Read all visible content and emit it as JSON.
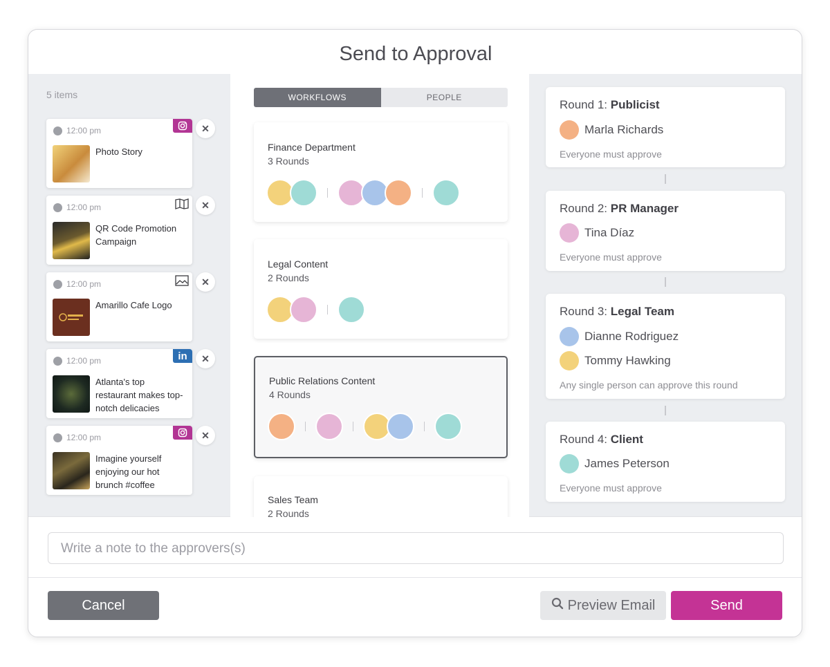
{
  "dialog": {
    "title": "Send to Approval"
  },
  "left": {
    "count_label": "5 items",
    "items": [
      {
        "time": "12:00 pm",
        "text": "Photo Story",
        "network": "instagram-icon",
        "badge_color": "#b23594"
      },
      {
        "time": "12:00 pm",
        "text": "QR Code Promotion Campaign",
        "network": "book-icon",
        "badge_color": ""
      },
      {
        "time": "12:00 pm",
        "text": "Amarillo Cafe Logo",
        "network": "image-icon",
        "badge_color": ""
      },
      {
        "time": "12:00 pm",
        "text": "Atlanta's top restaurant makes top-notch delicacies",
        "network": "linkedin-icon",
        "badge_color": "#2d6fb3",
        "badge_text": "in"
      },
      {
        "time": "12:00 pm",
        "text": "Imagine yourself enjoying our hot brunch #coffee",
        "network": "instagram-icon",
        "badge_color": "#b23594"
      }
    ],
    "remove_symbol": "✕"
  },
  "toggle": {
    "workflows": "WORKFLOWS",
    "people": "PEOPLE",
    "active": "workflows"
  },
  "workflows": [
    {
      "name": "Finance Department",
      "rounds": "3 Rounds"
    },
    {
      "name": "Legal Content",
      "rounds": "2 Rounds"
    },
    {
      "name": "Public Relations Content",
      "rounds": "4 Rounds",
      "selected": true
    },
    {
      "name": "Sales Team",
      "rounds": "2 Rounds"
    }
  ],
  "rounds": [
    {
      "prefix": "Round 1: ",
      "role": "Publicist",
      "people": [
        "Marla Richards"
      ],
      "rule": "Everyone must approve"
    },
    {
      "prefix": "Round 2: ",
      "role": "PR Manager",
      "people": [
        "Tina Díaz"
      ],
      "rule": "Everyone must approve"
    },
    {
      "prefix": "Round 3: ",
      "role": "Legal Team",
      "people": [
        "Dianne Rodriguez",
        "Tommy Hawking"
      ],
      "rule": "Any single person can approve this round"
    },
    {
      "prefix": "Round 4: ",
      "role": "Client",
      "people": [
        "James Peterson"
      ],
      "rule": "Everyone must approve"
    }
  ],
  "note": {
    "placeholder": "Write a note to the approvers(s)"
  },
  "footer": {
    "cancel": "Cancel",
    "preview": "Preview Email",
    "send": "Send"
  },
  "colors": {
    "accent": "#c43395",
    "neutral_button": "#6f7177"
  }
}
